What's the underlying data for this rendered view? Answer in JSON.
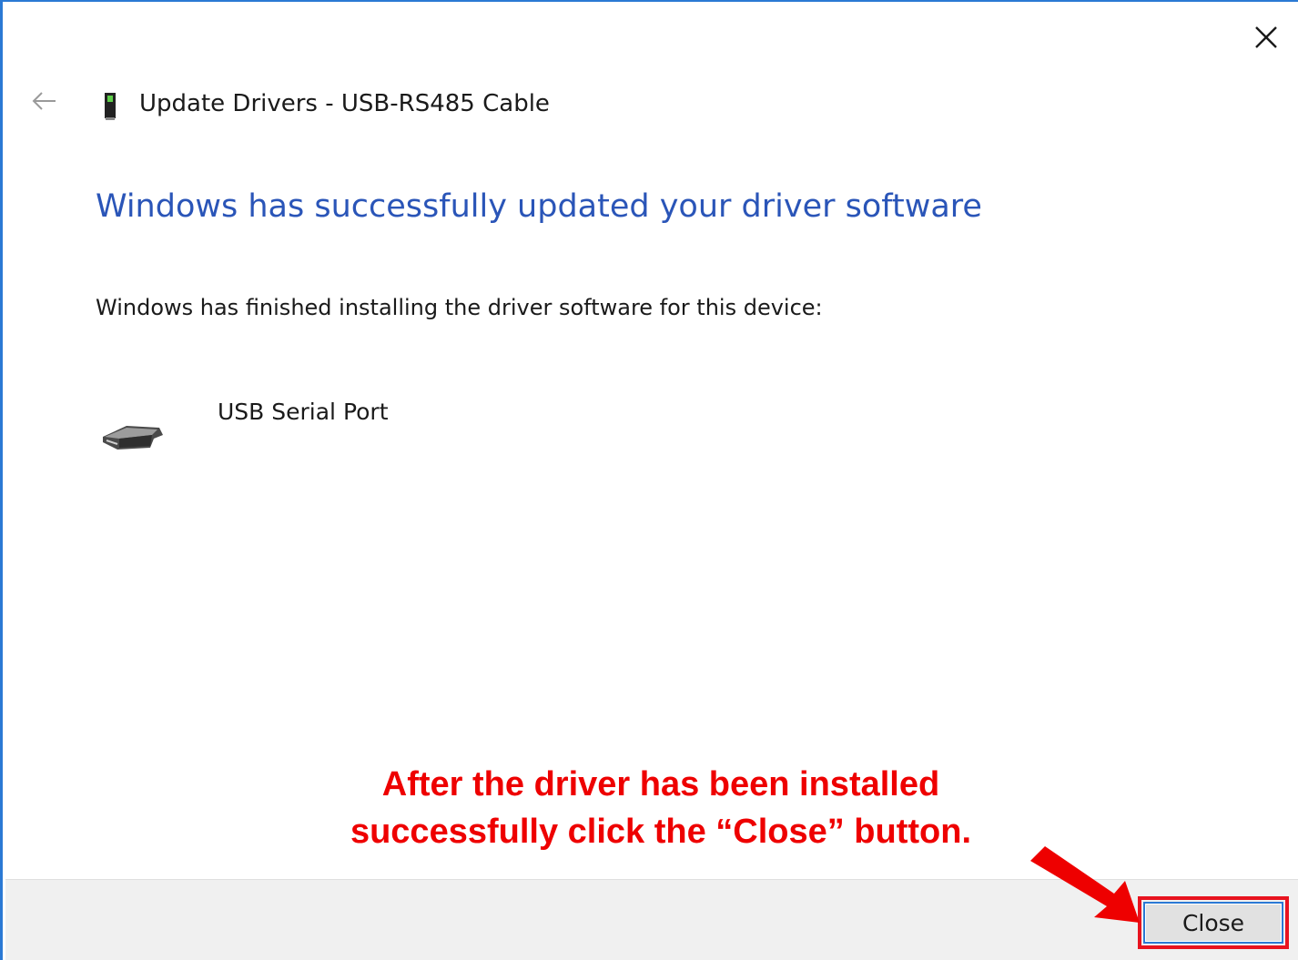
{
  "window": {
    "title": "Update Drivers - USB-RS485 Cable",
    "close_icon": "close-x-icon",
    "back_icon": "back-arrow-icon"
  },
  "content": {
    "headline": "Windows has successfully updated your driver software",
    "body": "Windows has finished installing the driver software for this device:",
    "device_name": "USB Serial Port",
    "device_icon": "serial-port-icon"
  },
  "annotation": {
    "line1": "After the driver has been installed",
    "line2": "successfully click the “Close” button.",
    "color": "#ee0000"
  },
  "footer": {
    "close_label": "Close"
  },
  "colors": {
    "headline": "#2a55b8",
    "accent_border": "#2b79d4",
    "highlight": "#e8131f"
  }
}
